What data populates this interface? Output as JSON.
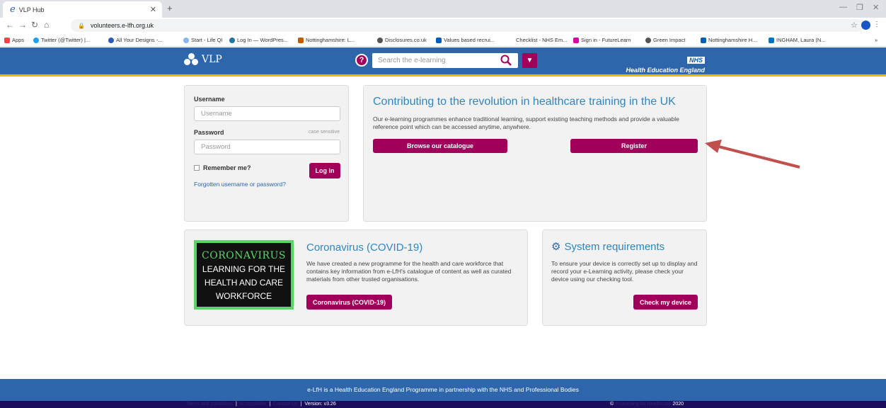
{
  "browser": {
    "tab_title": "VLP Hub",
    "url": "volunteers.e-lfh.org.uk",
    "bookmarks": [
      "Apps",
      "Twitter (@Twitter) |...",
      "All Your Designs -...",
      "Start - Life QI",
      "Log In — WordPres...",
      "Nottinghamshire: L...",
      "Disclosures.co.uk",
      "Values based recrui...",
      "Checklist - NHS Em...",
      "Sign in - FutureLearn",
      "Green Impact",
      "Nottinghamshire H...",
      "INGHAM, Laura (N..."
    ]
  },
  "header": {
    "logo_text": "VLP",
    "search_placeholder": "Search the e-learning",
    "nhs_badge": "NHS",
    "nhs_org": "Health Education England",
    "help_glyph": "?"
  },
  "login": {
    "username_label": "Username",
    "username_placeholder": "Username",
    "password_label": "Password",
    "case_note": "case sensitive",
    "password_placeholder": "Password",
    "remember_label": "Remember me?",
    "login_button": "Log in",
    "forgot_link": "Forgotten username or password?"
  },
  "hero": {
    "title": "Contributing to the revolution in healthcare training in the UK",
    "description": "Our e-learning programmes enhance traditional learning, support existing teaching methods and provide a valuable reference point which can be accessed anytime, anywhere.",
    "browse_button": "Browse our catalogue",
    "register_button": "Register"
  },
  "covid": {
    "image_line1": "CORONAVIRUS",
    "image_line2": "LEARNING FOR THE",
    "image_line3": "HEALTH AND CARE",
    "image_line4": "WORKFORCE",
    "title": "Coronavirus (COVID-19)",
    "description": "We have created a new programme for the health and care workforce that contains key information from e-LfH's catalogue of content as well as curated materials from other trusted organisations.",
    "button": "Coronavirus (COVID-19)"
  },
  "system": {
    "title": "System requirements",
    "description": "To ensure your device is correctly set up to display and record your e-Learning activity, please check your device using our checking tool.",
    "button": "Check my device"
  },
  "footer": {
    "text": "e-LfH is a Health Education England Programme in partnership with the NHS and Professional Bodies",
    "links": [
      "Terms and conditions",
      "Accessibility",
      "Contact Us"
    ],
    "version": "Version: v3.26",
    "copyright_symbol": "©",
    "copyright_org": "e-Learning for Healthcare",
    "year": "2020"
  },
  "colors": {
    "brand_blue": "#2e66ac",
    "brand_magenta": "#a0005a",
    "accent_gold": "#f4b400"
  }
}
